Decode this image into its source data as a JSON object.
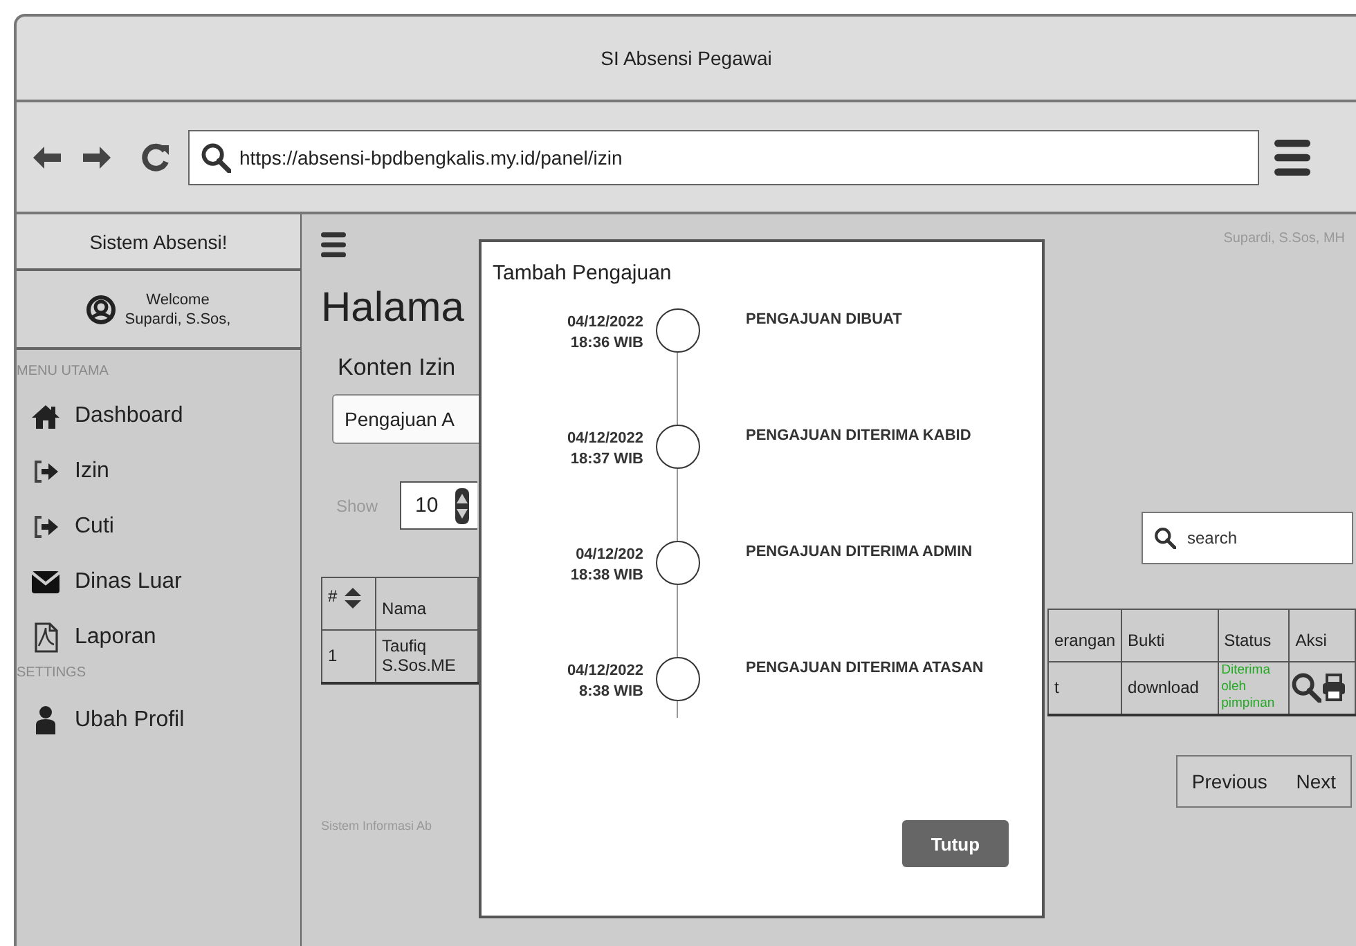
{
  "window": {
    "title": "SI Absensi Pegawai"
  },
  "browser": {
    "url": "https://absensi-bpdbengkalis.my.id/panel/izin"
  },
  "sidebar": {
    "brand": "Sistem Absensi!",
    "welcome": "Welcome",
    "user": "Supardi, S.Sos,",
    "sections": [
      {
        "heading": "MENU UTAMA",
        "items": [
          {
            "label": "Dashboard",
            "kind": "home"
          },
          {
            "label": "Izin",
            "kind": "enter"
          },
          {
            "label": "Cuti",
            "kind": "enter"
          },
          {
            "label": "Dinas Luar",
            "kind": "mail"
          },
          {
            "label": "Laporan",
            "kind": "document"
          }
        ]
      },
      {
        "heading": "SETTINGS",
        "items": [
          {
            "label": "Ubah Profil",
            "kind": "person"
          }
        ]
      }
    ]
  },
  "header": {
    "user": "Supardi, S.Sos, MH"
  },
  "page": {
    "title": "Halama",
    "subtitle": "Konten Izin",
    "select": "Pengajuan A",
    "show_label": "Show",
    "page_size": "10",
    "search": {
      "placeholder": "search"
    },
    "footer": "Sistem Informasi Ab"
  },
  "table_left": {
    "columns": [
      {
        "label": "#",
        "sortable": true
      },
      {
        "label": "Nama",
        "sortable": false
      }
    ],
    "rows": [
      {
        "cells": [
          {
            "kind": "text",
            "text": "1"
          },
          {
            "kind": "text",
            "text": "Taufiq S.Sos.ME"
          }
        ]
      }
    ]
  },
  "table_right": {
    "columns": [
      {
        "label": "erangan",
        "sortable": false
      },
      {
        "label": "Bukti",
        "sortable": false
      },
      {
        "label": "Status",
        "sortable": false
      },
      {
        "label": "Aksi",
        "sortable": false
      }
    ],
    "rows": [
      {
        "cells": [
          {
            "kind": "text",
            "text": "t"
          },
          {
            "kind": "text",
            "text": "download"
          },
          {
            "kind": "status",
            "text": "Diterima oleh pimpinan"
          },
          {
            "kind": "actions"
          }
        ]
      }
    ]
  },
  "pagination": [
    "Previous",
    "Next"
  ],
  "modal": {
    "title": "Tambah Pengajuan",
    "events": [
      {
        "date": "04/12/2022",
        "time": "18:36 WIB",
        "label": "PENGAJUAN DIBUAT"
      },
      {
        "date": "04/12/2022",
        "time": "18:37 WIB",
        "label": "PENGAJUAN DITERIMA KABID"
      },
      {
        "date": "04/12/202",
        "time": "18:38 WIB",
        "label": "PENGAJUAN DITERIMA ADMIN"
      },
      {
        "date": "04/12/2022",
        "time": "8:38 WIB",
        "label": "PENGAJUAN DITERIMA ATASAN"
      }
    ],
    "button": "Tutup"
  }
}
